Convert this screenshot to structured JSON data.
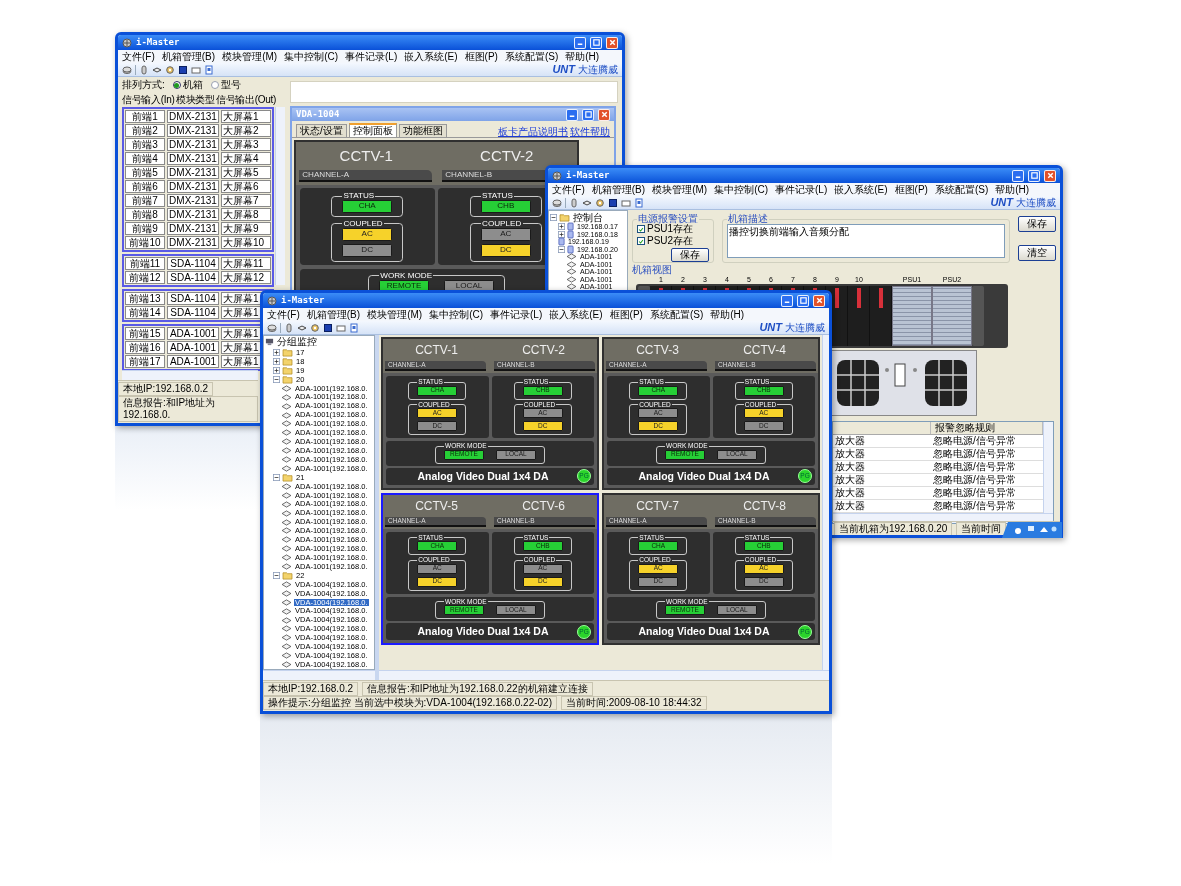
{
  "windows": [
    {
      "kind": "sorter",
      "title": "i-Master",
      "menu": [
        "文件(F)",
        "机箱管理(B)",
        "模块管理(M)",
        "集中控制(C)",
        "事件记录(L)",
        "嵌入系统(E)",
        "框图(P)",
        "系统配置(S)",
        "帮助(H)"
      ],
      "logo": {
        "mark": "UNT",
        "text": "大连腾威"
      },
      "sort": {
        "label": "排列方式:",
        "options": [
          {
            "label": "机箱",
            "selected": true
          },
          {
            "label": "型号",
            "selected": false
          }
        ]
      },
      "columns": [
        "信号输入(In)",
        "模块类型",
        "信号输出(Out)"
      ],
      "groups": [
        {
          "rows": [
            [
              "前端1",
              "DMX-2131",
              "大屏幕1"
            ],
            [
              "前端2",
              "DMX-2131",
              "大屏幕2"
            ],
            [
              "前端3",
              "DMX-2131",
              "大屏幕3"
            ],
            [
              "前端4",
              "DMX-2131",
              "大屏幕4"
            ],
            [
              "前端5",
              "DMX-2131",
              "大屏幕5"
            ],
            [
              "前端6",
              "DMX-2131",
              "大屏幕6"
            ],
            [
              "前端7",
              "DMX-2131",
              "大屏幕7"
            ],
            [
              "前端8",
              "DMX-2131",
              "大屏幕8"
            ],
            [
              "前端9",
              "DMX-2131",
              "大屏幕9"
            ],
            [
              "前端10",
              "DMX-2131",
              "大屏幕10"
            ]
          ]
        },
        {
          "rows": [
            [
              "前端11",
              "SDA-1104",
              "大屏幕11"
            ],
            [
              "前端12",
              "SDA-1104",
              "大屏幕12"
            ]
          ]
        },
        {
          "rows": [
            [
              "前端13",
              "SDA-1104",
              "大屏幕1"
            ],
            [
              "前端14",
              "SDA-1104",
              "大屏幕1"
            ]
          ]
        },
        {
          "rows": [
            [
              "前端15",
              "ADA-1001",
              "大屏幕1"
            ],
            [
              "前端16",
              "ADA-1001",
              "大屏幕1"
            ],
            [
              "前端17",
              "ADA-1001",
              "大屏幕1"
            ]
          ]
        }
      ],
      "subwindow": {
        "title": "VDA-1004",
        "tabs": [
          {
            "label": "状态/设置",
            "selected": false
          },
          {
            "label": "控制面板",
            "selected": true
          },
          {
            "label": "功能框图",
            "selected": false
          }
        ],
        "links": [
          "板卡产品说明书",
          "软件帮助"
        ],
        "module": {
          "channels": [
            {
              "title": "CCTV-1",
              "label": "CHANNEL-A",
              "status_legend": "STATUS",
              "status": {
                "label": "CHA",
                "on": true
              },
              "coupled_legend": "COUPLED",
              "coupled": [
                {
                  "label": "AC",
                  "on": true
                },
                {
                  "label": "DC",
                  "on": false
                }
              ]
            },
            {
              "title": "CCTV-2",
              "label": "CHANNEL-B",
              "status_legend": "STATUS",
              "status": {
                "label": "CHB",
                "on": true
              },
              "coupled_legend": "COUPLED",
              "coupled": [
                {
                  "label": "AC",
                  "on": false
                },
                {
                  "label": "DC",
                  "on": true
                }
              ]
            }
          ],
          "work_mode_legend": "WORK MODE",
          "work_mode": [
            {
              "label": "REMOTE",
              "on": true
            },
            {
              "label": "LOCAL",
              "on": false
            }
          ]
        }
      },
      "status_bar": [
        "本地IP:192.168.0.2",
        "信息报告:和IP地址为192.168.0."
      ]
    },
    {
      "kind": "chassis",
      "title": "i-Master",
      "menu": [
        "文件(F)",
        "机箱管理(B)",
        "模块管理(M)",
        "集中控制(C)",
        "事件记录(L)",
        "嵌入系统(E)",
        "框图(P)",
        "系统配置(S)",
        "帮助(H)"
      ],
      "logo": {
        "mark": "UNT",
        "text": "大连腾威"
      },
      "tree": {
        "kind": "folder",
        "label": "控制台",
        "expanded": true,
        "selected": false,
        "children": [
          {
            "kind": "host",
            "label": "192.168.0.17",
            "expanded": false,
            "selected": false
          },
          {
            "kind": "host",
            "label": "192.168.0.18",
            "expanded": false,
            "selected": false
          },
          {
            "kind": "host",
            "label": "192.168.0.19",
            "selected": false
          },
          {
            "kind": "host",
            "label": "192.168.0.20",
            "expanded": true,
            "selected": false,
            "children": [
              {
                "kind": "device",
                "label": "ADA-1001",
                "selected": false
              },
              {
                "kind": "device",
                "label": "ADA-1001",
                "selected": false
              },
              {
                "kind": "device",
                "label": "ADA-1001",
                "selected": false
              },
              {
                "kind": "device",
                "label": "ADA-1001",
                "selected": false
              },
              {
                "kind": "device",
                "label": "ADA-1001",
                "selected": false
              }
            ]
          }
        ]
      },
      "power": {
        "title": "电源报警设置",
        "checks": [
          {
            "label": "PSU1存在",
            "checked": true
          },
          {
            "label": "PSU2存在",
            "checked": true
          }
        ],
        "button": "保存"
      },
      "description": {
        "title": "机箱描述",
        "value": "播控切换前端输入音频分配",
        "buttons": [
          "保存",
          "清空"
        ]
      },
      "rack": {
        "title": "机箱视图",
        "slots": [
          "1",
          "2",
          "3",
          "4",
          "5",
          "6",
          "7",
          "8",
          "9",
          "10"
        ],
        "psus": [
          "PSU1",
          "PSU2"
        ]
      },
      "table": {
        "columns": [
          "",
          "报警忽略规则"
        ],
        "rows": [
          [
            "放大器",
            "忽略电源/信号异常"
          ],
          [
            "放大器",
            "忽略电源/信号异常"
          ],
          [
            "放大器",
            "忽略电源/信号异常"
          ],
          [
            "放大器",
            "忽略电源/信号异常"
          ],
          [
            "放大器",
            "忽略电源/信号异常"
          ],
          [
            "放大器",
            "忽略电源/信号异常"
          ]
        ]
      },
      "status_bar": [
        "当前机箱为192.168.0.20",
        "当前时间"
      ]
    },
    {
      "kind": "monitor",
      "title": "i-Master",
      "menu": [
        "文件(F)",
        "机箱管理(B)",
        "模块管理(M)",
        "集中控制(C)",
        "事件记录(L)",
        "嵌入系统(E)",
        "框图(P)",
        "系统配置(S)",
        "帮助(H)"
      ],
      "logo": {
        "mark": "UNT",
        "text": "大连腾威"
      },
      "tree": {
        "kind": "root",
        "label": "分组监控",
        "selected": false,
        "children": [
          {
            "kind": "folder",
            "label": "17",
            "expanded": false,
            "selected": false
          },
          {
            "kind": "folder",
            "label": "18",
            "expanded": false,
            "selected": false
          },
          {
            "kind": "folder",
            "label": "19",
            "expanded": false,
            "selected": false
          },
          {
            "kind": "folder",
            "label": "20",
            "expanded": true,
            "selected": false,
            "children": [
              {
                "kind": "device",
                "label": "ADA-1001(192.168.0.",
                "selected": false
              },
              {
                "kind": "device",
                "label": "ADA-1001(192.168.0.",
                "selected": false
              },
              {
                "kind": "device",
                "label": "ADA-1001(192.168.0.",
                "selected": false
              },
              {
                "kind": "device",
                "label": "ADA-1001(192.168.0.",
                "selected": false
              },
              {
                "kind": "device",
                "label": "ADA-1001(192.168.0.",
                "selected": false
              },
              {
                "kind": "device",
                "label": "ADA-1001(192.168.0.",
                "selected": false
              },
              {
                "kind": "device",
                "label": "ADA-1001(192.168.0.",
                "selected": false
              },
              {
                "kind": "device",
                "label": "ADA-1001(192.168.0.",
                "selected": false
              },
              {
                "kind": "device",
                "label": "ADA-1001(192.168.0.",
                "selected": false
              },
              {
                "kind": "device",
                "label": "ADA-1001(192.168.0.",
                "selected": false
              }
            ]
          },
          {
            "kind": "folder",
            "label": "21",
            "expanded": true,
            "selected": false,
            "children": [
              {
                "kind": "device",
                "label": "ADA-1001(192.168.0.",
                "selected": false
              },
              {
                "kind": "device",
                "label": "ADA-1001(192.168.0.",
                "selected": false
              },
              {
                "kind": "device",
                "label": "ADA-1001(192.168.0.",
                "selected": false
              },
              {
                "kind": "device",
                "label": "ADA-1001(192.168.0.",
                "selected": false
              },
              {
                "kind": "device",
                "label": "ADA-1001(192.168.0.",
                "selected": false
              },
              {
                "kind": "device",
                "label": "ADA-1001(192.168.0.",
                "selected": false
              },
              {
                "kind": "device",
                "label": "ADA-1001(192.168.0.",
                "selected": false
              },
              {
                "kind": "device",
                "label": "ADA-1001(192.168.0.",
                "selected": false
              },
              {
                "kind": "device",
                "label": "ADA-1001(192.168.0.",
                "selected": false
              },
              {
                "kind": "device",
                "label": "ADA-1001(192.168.0.",
                "selected": false
              }
            ]
          },
          {
            "kind": "folder",
            "label": "22",
            "expanded": true,
            "selected": false,
            "children": [
              {
                "kind": "device",
                "label": "VDA-1004(192.168.0.",
                "selected": false
              },
              {
                "kind": "device",
                "label": "VDA-1004(192.168.0.",
                "selected": false
              },
              {
                "kind": "device",
                "label": "VDA-1004(192.168.0.",
                "selected": true
              },
              {
                "kind": "device",
                "label": "VDA-1004(192.168.0.",
                "selected": false
              },
              {
                "kind": "device",
                "label": "VDA-1004(192.168.0.",
                "selected": false
              },
              {
                "kind": "device",
                "label": "VDA-1004(192.168.0.",
                "selected": false
              },
              {
                "kind": "device",
                "label": "VDA-1004(192.168.0.",
                "selected": false
              },
              {
                "kind": "device",
                "label": "VDA-1004(192.168.0.",
                "selected": false
              },
              {
                "kind": "device",
                "label": "VDA-1004(192.168.0.",
                "selected": false
              },
              {
                "kind": "device",
                "label": "VDA-1004(192.168.0.",
                "selected": false
              }
            ]
          }
        ]
      },
      "modules": [
        {
          "selected": false,
          "channels": [
            {
              "title": "CCTV-1",
              "label": "CHANNEL-A",
              "status_legend": "STATUS",
              "status": {
                "label": "CHA",
                "on": true
              },
              "coupled_legend": "COUPLED",
              "coupled": [
                {
                  "label": "AC",
                  "on": true
                },
                {
                  "label": "DC",
                  "on": false
                }
              ]
            },
            {
              "title": "CCTV-2",
              "label": "CHANNEL-B",
              "status_legend": "STATUS",
              "status": {
                "label": "CHB",
                "on": true
              },
              "coupled_legend": "COUPLED",
              "coupled": [
                {
                  "label": "AC",
                  "on": false
                },
                {
                  "label": "DC",
                  "on": true
                }
              ]
            }
          ],
          "work_mode_legend": "WORK MODE",
          "work_mode": [
            {
              "label": "REMOTE",
              "on": true
            },
            {
              "label": "LOCAL",
              "on": false
            }
          ],
          "name": "Analog Video Dual 1x4 DA",
          "indicator": "PG"
        },
        {
          "selected": false,
          "channels": [
            {
              "title": "CCTV-3",
              "label": "CHANNEL-A",
              "status_legend": "STATUS",
              "status": {
                "label": "CHA",
                "on": true
              },
              "coupled_legend": "COUPLED",
              "coupled": [
                {
                  "label": "AC",
                  "on": false
                },
                {
                  "label": "DC",
                  "on": true
                }
              ]
            },
            {
              "title": "CCTV-4",
              "label": "CHANNEL-B",
              "status_legend": "STATUS",
              "status": {
                "label": "CHB",
                "on": true
              },
              "coupled_legend": "COUPLED",
              "coupled": [
                {
                  "label": "AC",
                  "on": true
                },
                {
                  "label": "DC",
                  "on": false
                }
              ]
            }
          ],
          "work_mode_legend": "WORK MODE",
          "work_mode": [
            {
              "label": "REMOTE",
              "on": true
            },
            {
              "label": "LOCAL",
              "on": false
            }
          ],
          "name": "Analog Video Dual 1x4 DA",
          "indicator": "PG"
        },
        {
          "selected": true,
          "channels": [
            {
              "title": "CCTV-5",
              "label": "CHANNEL-A",
              "status_legend": "STATUS",
              "status": {
                "label": "CHA",
                "on": true
              },
              "coupled_legend": "COUPLED",
              "coupled": [
                {
                  "label": "AC",
                  "on": false
                },
                {
                  "label": "DC",
                  "on": true
                }
              ]
            },
            {
              "title": "CCTV-6",
              "label": "CHANNEL-B",
              "status_legend": "STATUS",
              "status": {
                "label": "CHB",
                "on": true
              },
              "coupled_legend": "COUPLED",
              "coupled": [
                {
                  "label": "AC",
                  "on": false
                },
                {
                  "label": "DC",
                  "on": true
                }
              ]
            }
          ],
          "work_mode_legend": "WORK MODE",
          "work_mode": [
            {
              "label": "REMOTE",
              "on": true
            },
            {
              "label": "LOCAL",
              "on": false
            }
          ],
          "name": "Analog Video Dual 1x4 DA",
          "indicator": "PG"
        },
        {
          "selected": false,
          "channels": [
            {
              "title": "CCTV-7",
              "label": "CHANNEL-A",
              "status_legend": "STATUS",
              "status": {
                "label": "CHA",
                "on": true
              },
              "coupled_legend": "COUPLED",
              "coupled": [
                {
                  "label": "AC",
                  "on": true
                },
                {
                  "label": "DC",
                  "on": false
                }
              ]
            },
            {
              "title": "CCTV-8",
              "label": "CHANNEL-B",
              "status_legend": "STATUS",
              "status": {
                "label": "CHB",
                "on": true
              },
              "coupled_legend": "COUPLED",
              "coupled": [
                {
                  "label": "AC",
                  "on": true
                },
                {
                  "label": "DC",
                  "on": false
                }
              ]
            }
          ],
          "work_mode_legend": "WORK MODE",
          "work_mode": [
            {
              "label": "REMOTE",
              "on": true
            },
            {
              "label": "LOCAL",
              "on": false
            }
          ],
          "name": "Analog Video Dual 1x4 DA",
          "indicator": "PG"
        }
      ],
      "status_bar": [
        "本地IP:192.168.0.2",
        "信息报告:和IP地址为192.168.0.22的机箱建立连接",
        "操作提示:分组监控  当前选中模块为:VDA-1004(192.168.0.22-02)",
        "当前时间:2009-08-10 18:44:32"
      ]
    }
  ]
}
